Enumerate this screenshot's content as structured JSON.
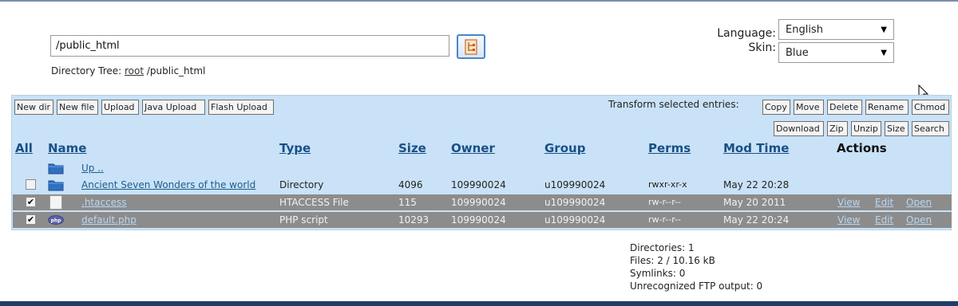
{
  "path_field": {
    "value": "/public_html"
  },
  "directory_tree": {
    "label": "Directory Tree:",
    "root_link": "root",
    "path": "/public_html"
  },
  "language": {
    "label": "Language:",
    "selected": "English"
  },
  "skin": {
    "label": "Skin:",
    "selected": "Blue"
  },
  "toolbar": {
    "left_buttons": [
      "New dir",
      "New file",
      "Upload",
      "Java Upload",
      "Flash Upload"
    ],
    "transform_label": "Transform selected entries:",
    "right_row1": [
      "Copy",
      "Move",
      "Delete",
      "Rename",
      "Chmod"
    ],
    "right_row2": [
      "Download",
      "Zip",
      "Unzip",
      "Size",
      "Search"
    ]
  },
  "columns": {
    "all": "All",
    "name": "Name",
    "type": "Type",
    "size": "Size",
    "owner": "Owner",
    "group": "Group",
    "perms": "Perms",
    "mod_time": "Mod Time",
    "actions": "Actions"
  },
  "up_row": {
    "name": "Up .."
  },
  "rows": [
    {
      "checked": false,
      "icon": "folder-icon",
      "name": "Ancient Seven Wonders of the world",
      "type": "Directory",
      "size": "4096",
      "owner": "109990024",
      "group": "u109990024",
      "perms": "rwxr-xr-x",
      "mod_time": "May 22 20:28",
      "actions": []
    },
    {
      "checked": true,
      "icon": "file-icon",
      "name": ".htaccess",
      "type": "HTACCESS File",
      "size": "115",
      "owner": "109990024",
      "group": "u109990024",
      "perms": "rw-r--r--",
      "mod_time": "May 20 2011",
      "actions": [
        "View",
        "Edit",
        "Open"
      ]
    },
    {
      "checked": true,
      "icon": "php-icon",
      "name": "default.php",
      "type": "PHP script",
      "size": "10293",
      "owner": "109990024",
      "group": "u109990024",
      "perms": "rw-r--r--",
      "mod_time": "May 22 20:24",
      "actions": [
        "View",
        "Edit",
        "Open"
      ]
    }
  ],
  "stats": {
    "directories": "Directories: 1",
    "files": "Files: 2 / 10.16 kB",
    "symlinks": "Symlinks: 0",
    "unrecognized": "Unrecognized FTP output: 0"
  },
  "colors": {
    "panel_bg": "#c9e2f7",
    "selected_row": "#8c8c8c",
    "header_link": "#1a4f86",
    "bottom_bar": "#1f3d66"
  }
}
